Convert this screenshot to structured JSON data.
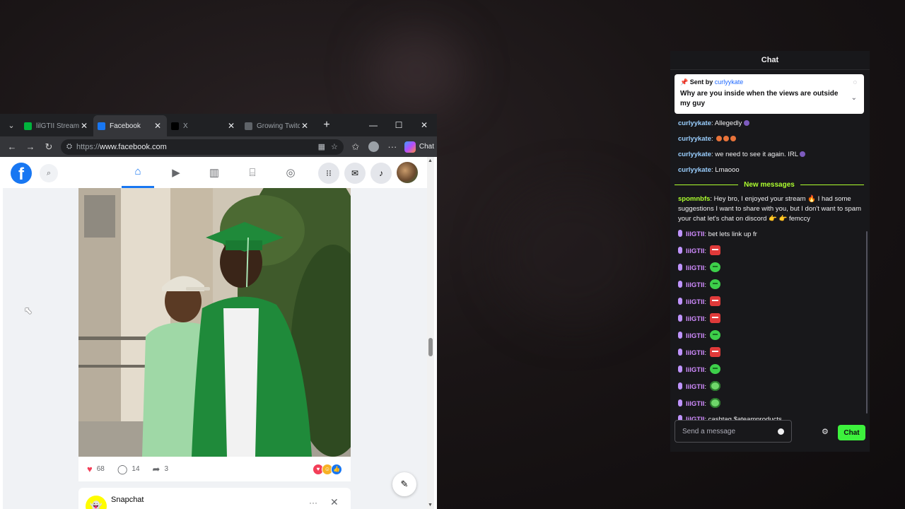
{
  "browser": {
    "tabs": [
      {
        "title": "lilGTII Stream",
        "favicon": "stream-favicon",
        "color": "#00b33c",
        "active": false
      },
      {
        "title": "Facebook",
        "favicon": "facebook-favicon",
        "color": "#1877f2",
        "active": true
      },
      {
        "title": "X",
        "favicon": "x-favicon",
        "color": "#000000",
        "active": false
      },
      {
        "title": "Growing Twitc",
        "favicon": "growing-favicon",
        "color": "#5f6368",
        "active": false
      }
    ],
    "new_tab_icon": "+",
    "address": {
      "scheme": "https://",
      "host": "www.facebook.com"
    },
    "copilot_label": "Chat"
  },
  "facebook": {
    "logo_letter": "f",
    "post": {
      "likes": "68",
      "comments": "14",
      "shares": "3"
    },
    "next_post": {
      "page_name": "Snapchat"
    }
  },
  "chat": {
    "title": "Chat",
    "pinned": {
      "sent_by_prefix": "Sent by",
      "user": "curlyykate",
      "message": "Why are you inside when the views are outside my guy"
    },
    "messages_before": [
      {
        "user": "curlyykate",
        "text": "Allegedly",
        "tail": "purple-dot"
      },
      {
        "user": "curlyykate",
        "text": "",
        "tail": "three-emotes"
      },
      {
        "user": "curlyykate",
        "text": "we need to see it again. IRL",
        "tail": "purple-dot"
      },
      {
        "user": "curlyykate",
        "text": "Lmaooo",
        "tail": ""
      }
    ],
    "new_messages_label": "New messages",
    "spom": {
      "user": "spomnbfs",
      "text": "Hey bro, I enjoyed your stream 🔥 I had some suggestions I want to share with you, but I don't want to spam your chat let's chat on discord 👉 👉 femccy"
    },
    "lil_messages": [
      {
        "user": "lilGTII",
        "text": "bet lets link up fr",
        "emote": ""
      },
      {
        "user": "lilGTII",
        "text": "",
        "emote": "red"
      },
      {
        "user": "lilGTII",
        "text": "",
        "emote": "green"
      },
      {
        "user": "lilGTII",
        "text": "",
        "emote": "green"
      },
      {
        "user": "lilGTII",
        "text": "",
        "emote": "red"
      },
      {
        "user": "lilGTII",
        "text": "",
        "emote": "red"
      },
      {
        "user": "lilGTII",
        "text": "",
        "emote": "green"
      },
      {
        "user": "lilGTII",
        "text": "",
        "emote": "red"
      },
      {
        "user": "lilGTII",
        "text": "",
        "emote": "green"
      },
      {
        "user": "lilGTII",
        "text": "",
        "emote": "alien"
      },
      {
        "user": "lilGTII",
        "text": "",
        "emote": "alien"
      },
      {
        "user": "lilGTII",
        "text": "cashtag $ateamproducts",
        "emote": ""
      }
    ],
    "input_placeholder": "Send a message",
    "send_label": "Chat"
  },
  "colors": {
    "facebook_blue": "#1877f2",
    "twitch_chat_bg": "#18181b",
    "new_messages_green": "#adff2f",
    "chat_button_green": "#3df23d"
  }
}
